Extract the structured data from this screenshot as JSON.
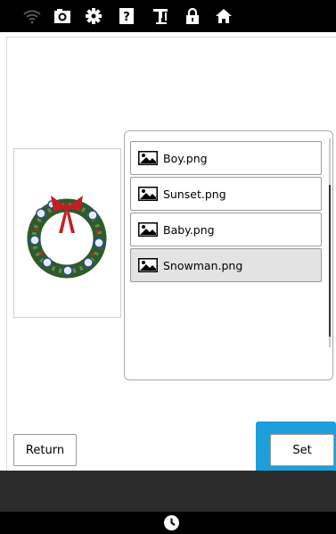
{
  "top_icons": [
    {
      "name": "wifi-icon",
      "enabled": false
    },
    {
      "name": "camera-icon",
      "enabled": true
    },
    {
      "name": "gear-icon",
      "enabled": true
    },
    {
      "name": "help-icon",
      "enabled": true
    },
    {
      "name": "machine-icon",
      "enabled": true
    },
    {
      "name": "lock-icon",
      "enabled": true
    },
    {
      "name": "home-icon",
      "enabled": true
    }
  ],
  "preview": {
    "icon": "wreath-image"
  },
  "files": [
    {
      "name": "Boy.png",
      "selected": false
    },
    {
      "name": "Sunset.png",
      "selected": false
    },
    {
      "name": "Baby.png",
      "selected": false
    },
    {
      "name": "Snowman.png",
      "selected": true
    }
  ],
  "buttons": {
    "return_label": "Return",
    "set_label": "Set"
  },
  "colors": {
    "highlight": "#1e9fdc",
    "topbar": "#000000"
  },
  "bottom_icon": "clock-icon"
}
